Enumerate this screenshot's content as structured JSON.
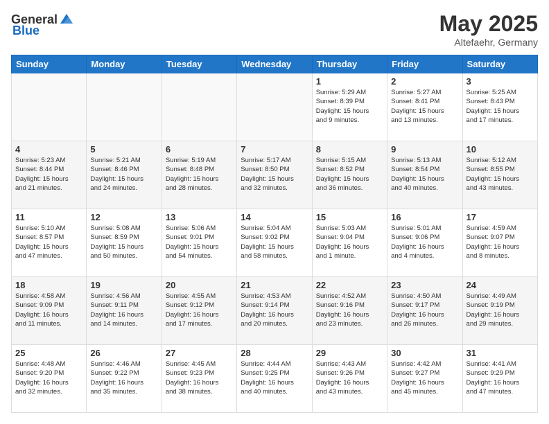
{
  "header": {
    "logo_general": "General",
    "logo_blue": "Blue",
    "title": "May 2025",
    "location": "Altefaehr, Germany"
  },
  "weekdays": [
    "Sunday",
    "Monday",
    "Tuesday",
    "Wednesday",
    "Thursday",
    "Friday",
    "Saturday"
  ],
  "weeks": [
    [
      {
        "day": "",
        "info": ""
      },
      {
        "day": "",
        "info": ""
      },
      {
        "day": "",
        "info": ""
      },
      {
        "day": "",
        "info": ""
      },
      {
        "day": "1",
        "info": "Sunrise: 5:29 AM\nSunset: 8:39 PM\nDaylight: 15 hours\nand 9 minutes."
      },
      {
        "day": "2",
        "info": "Sunrise: 5:27 AM\nSunset: 8:41 PM\nDaylight: 15 hours\nand 13 minutes."
      },
      {
        "day": "3",
        "info": "Sunrise: 5:25 AM\nSunset: 8:43 PM\nDaylight: 15 hours\nand 17 minutes."
      }
    ],
    [
      {
        "day": "4",
        "info": "Sunrise: 5:23 AM\nSunset: 8:44 PM\nDaylight: 15 hours\nand 21 minutes."
      },
      {
        "day": "5",
        "info": "Sunrise: 5:21 AM\nSunset: 8:46 PM\nDaylight: 15 hours\nand 24 minutes."
      },
      {
        "day": "6",
        "info": "Sunrise: 5:19 AM\nSunset: 8:48 PM\nDaylight: 15 hours\nand 28 minutes."
      },
      {
        "day": "7",
        "info": "Sunrise: 5:17 AM\nSunset: 8:50 PM\nDaylight: 15 hours\nand 32 minutes."
      },
      {
        "day": "8",
        "info": "Sunrise: 5:15 AM\nSunset: 8:52 PM\nDaylight: 15 hours\nand 36 minutes."
      },
      {
        "day": "9",
        "info": "Sunrise: 5:13 AM\nSunset: 8:54 PM\nDaylight: 15 hours\nand 40 minutes."
      },
      {
        "day": "10",
        "info": "Sunrise: 5:12 AM\nSunset: 8:55 PM\nDaylight: 15 hours\nand 43 minutes."
      }
    ],
    [
      {
        "day": "11",
        "info": "Sunrise: 5:10 AM\nSunset: 8:57 PM\nDaylight: 15 hours\nand 47 minutes."
      },
      {
        "day": "12",
        "info": "Sunrise: 5:08 AM\nSunset: 8:59 PM\nDaylight: 15 hours\nand 50 minutes."
      },
      {
        "day": "13",
        "info": "Sunrise: 5:06 AM\nSunset: 9:01 PM\nDaylight: 15 hours\nand 54 minutes."
      },
      {
        "day": "14",
        "info": "Sunrise: 5:04 AM\nSunset: 9:02 PM\nDaylight: 15 hours\nand 58 minutes."
      },
      {
        "day": "15",
        "info": "Sunrise: 5:03 AM\nSunset: 9:04 PM\nDaylight: 16 hours\nand 1 minute."
      },
      {
        "day": "16",
        "info": "Sunrise: 5:01 AM\nSunset: 9:06 PM\nDaylight: 16 hours\nand 4 minutes."
      },
      {
        "day": "17",
        "info": "Sunrise: 4:59 AM\nSunset: 9:07 PM\nDaylight: 16 hours\nand 8 minutes."
      }
    ],
    [
      {
        "day": "18",
        "info": "Sunrise: 4:58 AM\nSunset: 9:09 PM\nDaylight: 16 hours\nand 11 minutes."
      },
      {
        "day": "19",
        "info": "Sunrise: 4:56 AM\nSunset: 9:11 PM\nDaylight: 16 hours\nand 14 minutes."
      },
      {
        "day": "20",
        "info": "Sunrise: 4:55 AM\nSunset: 9:12 PM\nDaylight: 16 hours\nand 17 minutes."
      },
      {
        "day": "21",
        "info": "Sunrise: 4:53 AM\nSunset: 9:14 PM\nDaylight: 16 hours\nand 20 minutes."
      },
      {
        "day": "22",
        "info": "Sunrise: 4:52 AM\nSunset: 9:16 PM\nDaylight: 16 hours\nand 23 minutes."
      },
      {
        "day": "23",
        "info": "Sunrise: 4:50 AM\nSunset: 9:17 PM\nDaylight: 16 hours\nand 26 minutes."
      },
      {
        "day": "24",
        "info": "Sunrise: 4:49 AM\nSunset: 9:19 PM\nDaylight: 16 hours\nand 29 minutes."
      }
    ],
    [
      {
        "day": "25",
        "info": "Sunrise: 4:48 AM\nSunset: 9:20 PM\nDaylight: 16 hours\nand 32 minutes."
      },
      {
        "day": "26",
        "info": "Sunrise: 4:46 AM\nSunset: 9:22 PM\nDaylight: 16 hours\nand 35 minutes."
      },
      {
        "day": "27",
        "info": "Sunrise: 4:45 AM\nSunset: 9:23 PM\nDaylight: 16 hours\nand 38 minutes."
      },
      {
        "day": "28",
        "info": "Sunrise: 4:44 AM\nSunset: 9:25 PM\nDaylight: 16 hours\nand 40 minutes."
      },
      {
        "day": "29",
        "info": "Sunrise: 4:43 AM\nSunset: 9:26 PM\nDaylight: 16 hours\nand 43 minutes."
      },
      {
        "day": "30",
        "info": "Sunrise: 4:42 AM\nSunset: 9:27 PM\nDaylight: 16 hours\nand 45 minutes."
      },
      {
        "day": "31",
        "info": "Sunrise: 4:41 AM\nSunset: 9:29 PM\nDaylight: 16 hours\nand 47 minutes."
      }
    ]
  ]
}
